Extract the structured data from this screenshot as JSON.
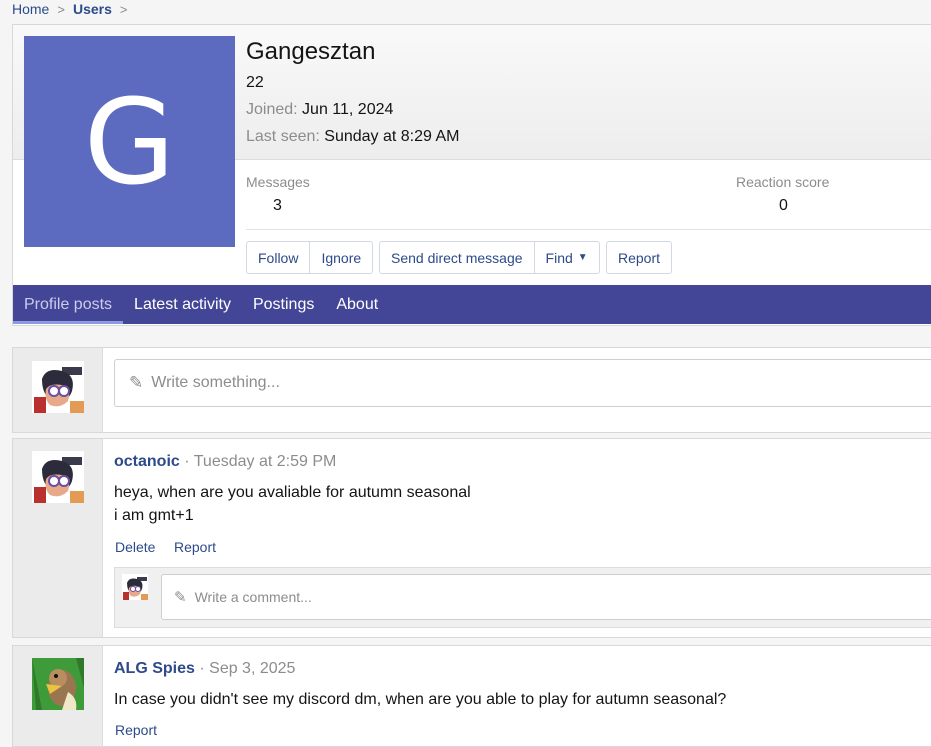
{
  "breadcrumb": {
    "home": "Home",
    "users": "Users"
  },
  "profile": {
    "avatar_letter": "G",
    "avatar_color": "#5c6bc0",
    "username": "Gangesztan",
    "age": "22",
    "joined_label": "Joined:",
    "joined_value": "Jun 11, 2024",
    "last_seen_label": "Last seen:",
    "last_seen_value": "Sunday at 8:29 AM",
    "messages_label": "Messages",
    "messages_value": "3",
    "reaction_label": "Reaction score",
    "reaction_value": "0",
    "buttons": {
      "follow": "Follow",
      "ignore": "Ignore",
      "dm": "Send direct message",
      "find": "Find",
      "report": "Report"
    }
  },
  "tabs": [
    "Profile posts",
    "Latest activity",
    "Postings",
    "About"
  ],
  "write": {
    "placeholder": "Write something..."
  },
  "posts": [
    {
      "author": "octanoic",
      "time": "Tuesday at 2:59 PM",
      "line1": "heya, when are you avaliable for autumn seasonal",
      "line2": "i am gmt+1",
      "delete": "Delete",
      "report": "Report",
      "comment_placeholder": "Write a comment..."
    },
    {
      "author": "ALG Spies",
      "time": "Sep 3, 2025",
      "line1": "In case you didn't see my discord dm, when are you able to play for autumn seasonal?",
      "report": "Report"
    }
  ],
  "colors": {
    "accent": "#434597",
    "link": "#2d4a8a"
  }
}
